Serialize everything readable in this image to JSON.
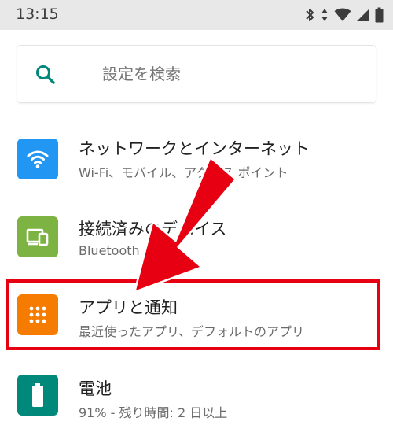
{
  "status_bar": {
    "time": "13:15",
    "icons": [
      "bluetooth-icon",
      "data-arrows-icon",
      "wifi-icon",
      "signal-icon",
      "battery-icon"
    ]
  },
  "search": {
    "placeholder": "設定を検索"
  },
  "items": [
    {
      "title": "ネットワークとインターネット",
      "subtitle": "Wi-Fi、モバイル、アクセス ポイント",
      "icon": "wifi-icon",
      "color": "#2196f3"
    },
    {
      "title": "接続済みのデバイス",
      "subtitle": "Bluetooth",
      "icon": "devices-icon",
      "color": "#7cb342"
    },
    {
      "title": "アプリと通知",
      "subtitle": "最近使ったアプリ、デフォルトのアプリ",
      "icon": "apps-icon",
      "color": "#f57c00"
    },
    {
      "title": "電池",
      "subtitle": "91% - 残り時間: 2 日以上",
      "icon": "battery-icon",
      "color": "#00897b"
    }
  ],
  "annotation": {
    "color": "#e60012"
  }
}
